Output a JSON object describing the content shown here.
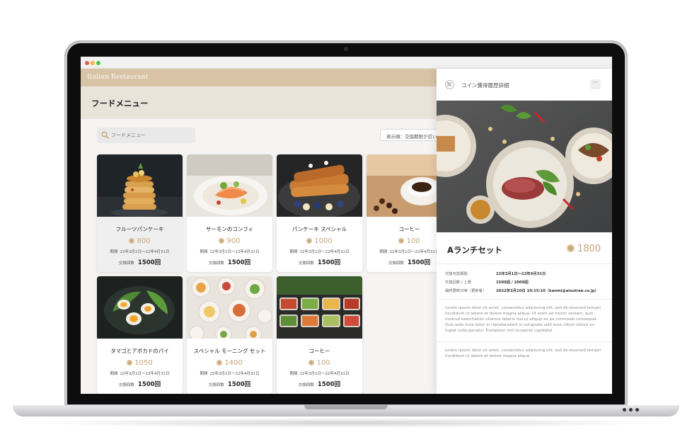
{
  "app": {
    "brand": "Italian Restaurant",
    "page_title": "フードメニュー"
  },
  "search": {
    "placeholder": "フードメニュー"
  },
  "sort": {
    "label": "表示順：交換期限が近い"
  },
  "labels": {
    "period": "期間",
    "exchange": "交換回数"
  },
  "menu": [
    {
      "name": "フルーツパンケーキ",
      "coins": "800",
      "period": "22年3月1日〜22年4月31日",
      "exchange": "1500回"
    },
    {
      "name": "サーモンのコンフィ",
      "coins": "900",
      "period": "22年3月1日〜22年4月31日",
      "exchange": "1500回"
    },
    {
      "name": "パンケーキ スペシャル",
      "coins": "1000",
      "period": "22年3月1日〜22年4月31日",
      "exchange": "1500回"
    },
    {
      "name": "コーヒー",
      "coins": "100",
      "period": "22年3月1日〜22年4月31日",
      "exchange": "1500回"
    },
    {
      "name": "タマゴとアボカドのパイ",
      "coins": "1050",
      "period": "22年3月1日〜22年4月31日",
      "exchange": "1500回"
    },
    {
      "name": "スペシャル モーニング セット",
      "coins": "1400",
      "period": "22年3月1日〜22年4月31日",
      "exchange": "1500回"
    },
    {
      "name": "コーヒー",
      "coins": "100",
      "period": "22年3月1日〜22年4月31日",
      "exchange": "1500回"
    }
  ],
  "detail": {
    "header_title": "コイン獲得履歴詳細",
    "more_label": "···",
    "name": "Aランチセット",
    "coins": "1800",
    "info": [
      {
        "key": "交換可能期間",
        "value": "22年3月1日〜22年4月31日"
      },
      {
        "key": "交換回数 / 上限",
        "value": "1500回 / 2000回"
      },
      {
        "key": "最終更新日時（更新者）",
        "value": "2022年3月10日 10:15:10（kanmi@aisutrae.co.jp）"
      }
    ],
    "paragraph1": "Lorem ipsum dolor sit amet, consectetur adipiscing elit, sed do eiusmod tempor incididunt ut labore et dolore magna aliqua. Ut enim ad minim veniam, quis nostrud exercitation ullamco laboris nisi ut aliquip ex ea commodo consequat. Duis aute irure dolor in reprehenderit in voluptate velit esse cillum dolore eu fugiat nulla pariatur. Excepteur sint occaecat cupidatat",
    "paragraph2": "Lorem ipsum dolor sit amet, consectetur adipiscing elit, sed do eiusmod tempor incididunt ut labore et dolore magna aliqua"
  },
  "colors": {
    "brand_bar": "#d8c3a6",
    "header_bg": "#eae3da",
    "coin_gold": "#c6a47a"
  },
  "icons": {
    "search": "search-icon",
    "close": "close-circle-icon",
    "more": "more-icon",
    "coin": "coin-icon"
  }
}
